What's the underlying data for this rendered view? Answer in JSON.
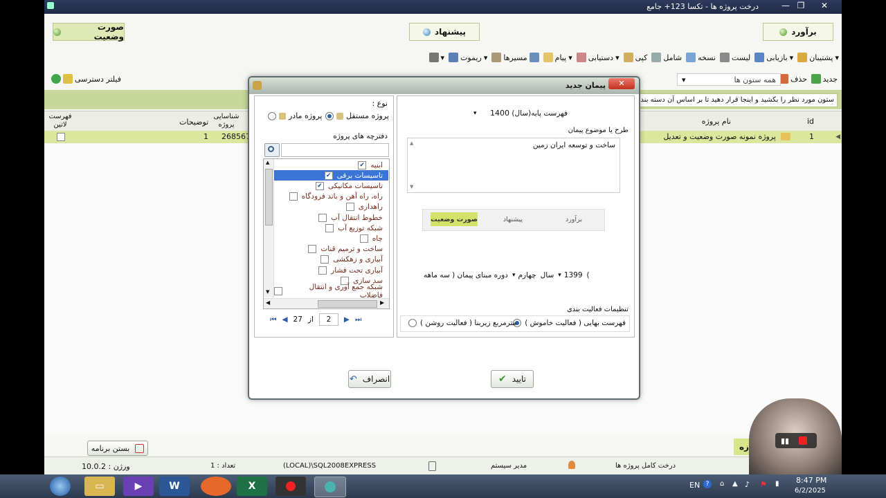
{
  "window": {
    "title": "درخت پروژه ها - تکسا 123+ جامع",
    "close": "✕",
    "maximize": "❐",
    "minimize": "—"
  },
  "modes": {
    "soorat": "صورت وضعیت",
    "pishnahad": "پیشنهاد",
    "baravord": "برآورد"
  },
  "toolbar": [
    "پشتیبان",
    "بازیابی",
    "لیست",
    "نسخه",
    "شامل",
    "کپی",
    "دستیابی",
    "پیام",
    "مسیرها",
    "ریموت"
  ],
  "toolbar2": {
    "new": "جدید",
    "delete": "حذف",
    "all_columns": "همه ستون ها",
    "access_filter": "فیلتر دسترسی"
  },
  "group_hint": "ستون مورد نظر را بکشید و اینجا قرار دهید تا بر اساس آن دسته بندی",
  "grid": {
    "columns": {
      "id": "id",
      "name": "نام پروژه",
      "code": "شناسایی پروژه",
      "desc": "توضیحات",
      "latin": "فهرست لاتین"
    },
    "row": {
      "id": "1",
      "name": "پروژه نمونه صورت وضعیت و تعدیل",
      "code": "268567",
      "desc": "1"
    }
  },
  "dialog": {
    "title": "پیمان جدید",
    "type_label": "نوع :",
    "type_independent": "پروژه مستقل",
    "type_parent": "پروژه مادر",
    "books_label": "دفترچه های پروژه",
    "books": [
      {
        "label": "ابنیه",
        "checked": true
      },
      {
        "label": "تاسیسات برقی",
        "checked": true
      },
      {
        "label": "تاسیسات مکانیکی",
        "checked": true
      },
      {
        "label": "راه، راه آهن و باند فرودگاه",
        "checked": false
      },
      {
        "label": "راهداری",
        "checked": false
      },
      {
        "label": "خطوط انتقال آب",
        "checked": false
      },
      {
        "label": "شبکه توزیع آب",
        "checked": false
      },
      {
        "label": "چاه",
        "checked": false
      },
      {
        "label": "ساخت و ترمیم قنات",
        "checked": false
      },
      {
        "label": "آبیاری و زهکشی",
        "checked": false
      },
      {
        "label": "آبیاری تحت فشار",
        "checked": false
      },
      {
        "label": "سد سازی",
        "checked": false
      },
      {
        "label": "شبکه جمع آوری و انتقال فاضلاب",
        "checked": false
      }
    ],
    "pager": {
      "page": "2",
      "of": "از",
      "total": "27"
    },
    "base_list_label": "فهرست پایه(سال)",
    "base_year": "1400",
    "plan_label": "طرح یا موضوع پیمان",
    "plan_text": "ساخت و توسعه ایران زمین",
    "segments": {
      "baravord": "برآورد",
      "pishnahad": "پیشنهاد",
      "soorat": "صورت وضعیت"
    },
    "period_label": "دوره مبنای پیمان ( سه ماهه",
    "period_quarter": "چهارم",
    "period_year_label": "سال",
    "period_year": "1399",
    "period_close": ")",
    "activity_label": "تنظیمات فعالیت بندی",
    "activity_off": "فهرست بهایی ( فعالیت خاموش )",
    "activity_on": "مترمربع زیربنا ( فعالیت روشن )",
    "ok": "تایید",
    "cancel": "انصراف"
  },
  "bottom": {
    "close_program": "بستن برنامه",
    "partial": "زه"
  },
  "status": {
    "version": "ورژن : 10.0.2",
    "count": "تعداد : 1",
    "server": "(LOCAL)\\SQL2008EXPRESS",
    "user": "مدیر سیستم",
    "tree": "درخت کامل پروژه ها"
  },
  "taskbar": {
    "lang": "EN",
    "time": "8:47 PM",
    "date": "6/2/2025"
  },
  "colors": {
    "accent_green": "#c8d79a",
    "row_green": "#dbe79d",
    "selection": "#3a74d6",
    "taskbar": "#34465e"
  }
}
